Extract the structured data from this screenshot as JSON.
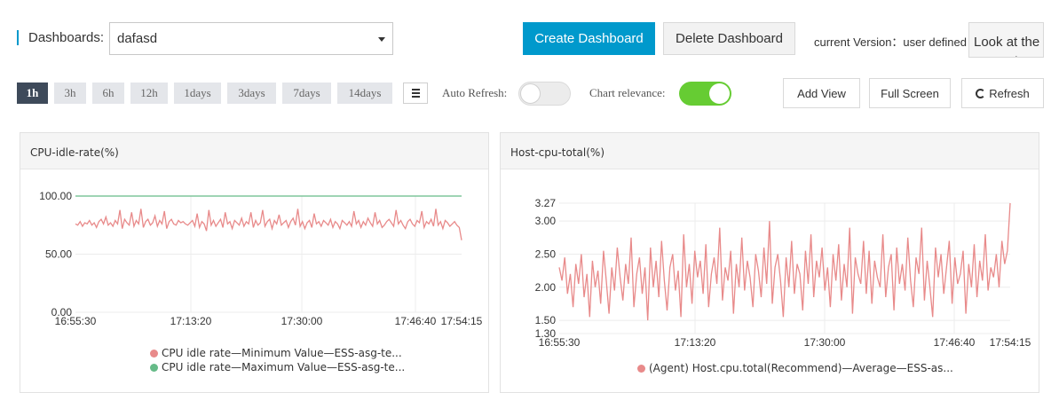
{
  "header": {
    "dashboards_label": "Dashboards:",
    "selected_dashboard": "dafasd",
    "create_label": "Create Dashboard",
    "delete_label": "Delete Dashboard",
    "version_label": "current Version：user defined",
    "look_label": "Look at the amount"
  },
  "toolbar": {
    "time_ranges": [
      "1h",
      "3h",
      "6h",
      "12h",
      "1days",
      "3days",
      "7days",
      "14days"
    ],
    "active_range": "1h",
    "auto_refresh_label": "Auto Refresh:",
    "auto_refresh_on": false,
    "chart_relevance_label": "Chart relevance:",
    "chart_relevance_on": true,
    "add_view_label": "Add View",
    "full_screen_label": "Full Screen",
    "refresh_label": "Refresh"
  },
  "colors": {
    "primary": "#0099cc",
    "series_red": "#e88a8a",
    "series_green": "#66bb88",
    "toggle_on": "#66cc33"
  },
  "chart_data": [
    {
      "type": "line",
      "title": "CPU-idle-rate(%)",
      "x_ticks": [
        "16:55:30",
        "17:13:20",
        "17:30:00",
        "17:46:40",
        "17:54:15"
      ],
      "y_ticks": [
        "0.00",
        "50.00",
        "100.00"
      ],
      "ylim": [
        0,
        100
      ],
      "grid": true,
      "legend_position": "bottom",
      "series": [
        {
          "name": "CPU idle rate—Minimum Value—ESS-asg-te...",
          "color": "#e88a8a",
          "values": [
            76,
            75,
            78,
            74,
            77,
            76,
            79,
            75,
            77,
            73,
            78,
            80,
            76,
            82,
            75,
            77,
            74,
            79,
            76,
            88,
            72,
            80,
            77,
            75,
            86,
            74,
            79,
            76,
            89,
            73,
            78,
            80,
            75,
            77,
            83,
            74,
            79,
            76,
            87,
            72,
            78,
            80,
            76,
            75,
            79,
            77,
            78,
            76,
            75,
            77,
            79,
            74,
            85,
            73,
            78,
            76,
            70,
            88,
            75,
            79,
            74,
            77,
            80,
            73,
            86,
            76,
            78,
            72,
            79,
            77,
            75,
            81,
            74,
            78,
            76,
            86,
            73,
            79,
            75,
            77,
            88,
            74,
            78,
            80,
            72,
            79,
            76,
            84,
            75,
            77,
            79,
            73,
            78,
            81,
            75,
            89,
            74,
            78,
            72,
            77,
            79,
            73,
            85,
            76,
            78,
            74,
            79,
            77,
            75,
            80,
            73,
            78,
            76,
            72,
            79,
            77,
            75,
            78,
            74,
            87,
            76,
            79,
            73,
            78,
            75,
            81,
            77,
            74,
            86,
            76,
            79,
            73,
            75,
            78,
            80,
            77,
            74,
            88,
            76,
            79,
            75,
            72,
            78,
            80,
            76,
            74,
            79,
            77,
            87,
            73,
            78,
            76,
            80,
            74,
            89,
            75,
            78,
            72,
            79,
            77,
            74,
            76,
            78,
            75,
            73,
            62
          ]
        },
        {
          "name": "CPU idle rate—Maximum Value—ESS-asg-te...",
          "color": "#66bb88",
          "values": [
            100,
            100
          ]
        }
      ]
    },
    {
      "type": "line",
      "title": "Host-cpu-total(%)",
      "x_ticks": [
        "16:55:30",
        "17:13:20",
        "17:30:00",
        "17:46:40",
        "17:54:15"
      ],
      "y_ticks": [
        "1.30",
        "1.50",
        "2.00",
        "2.50",
        "3.00",
        "3.27"
      ],
      "ylim": [
        1.3,
        3.27
      ],
      "grid": true,
      "legend_position": "bottom",
      "series": [
        {
          "name": "(Agent) Host.cpu.total(Recommend)—Average—ESS-as...",
          "color": "#e88a8a",
          "values": [
            2.3,
            2.1,
            2.45,
            1.9,
            2.2,
            1.7,
            2.35,
            2.05,
            2.5,
            1.85,
            2.2,
            1.55,
            2.4,
            2.0,
            2.25,
            1.75,
            2.55,
            2.1,
            1.6,
            2.3,
            1.95,
            2.6,
            2.15,
            1.8,
            2.35,
            2.05,
            2.75,
            1.7,
            2.2,
            2.45,
            1.9,
            2.3,
            1.5,
            2.6,
            2.0,
            2.4,
            1.85,
            2.7,
            2.1,
            1.65,
            2.3,
            2.5,
            1.95,
            2.25,
            1.55,
            2.8,
            2.0,
            2.35,
            1.75,
            2.55,
            2.15,
            2.4,
            1.9,
            2.65,
            1.7,
            2.2,
            2.45,
            2.05,
            2.9,
            1.8,
            2.3,
            2.1,
            2.55,
            1.6,
            2.35,
            2.0,
            2.75,
            1.95,
            2.4,
            2.15,
            1.7,
            2.5,
            2.25,
            1.85,
            2.6,
            2.05,
            3.0,
            1.75,
            2.3,
            2.5,
            2.1,
            1.55,
            2.45,
            2.0,
            2.7,
            1.9,
            2.35,
            2.2,
            1.65,
            2.55,
            2.05,
            2.8,
            1.85,
            2.4,
            2.15,
            2.6,
            1.95,
            2.3,
            1.7,
            2.5,
            2.1,
            2.65,
            1.8,
            2.35,
            2.0,
            2.9,
            1.6,
            2.45,
            2.2,
            2.05,
            2.7,
            1.9,
            2.55,
            1.75,
            2.4,
            2.15,
            2.0,
            2.8,
            1.85,
            2.3,
            2.5,
            1.65,
            2.6,
            2.05,
            2.35,
            1.95,
            2.75,
            2.1,
            1.7,
            2.45,
            2.2,
            2.9,
            1.8,
            2.4,
            2.0,
            1.55,
            2.6,
            2.15,
            2.5,
            1.9,
            2.3,
            2.7,
            1.75,
            2.45,
            2.05,
            2.2,
            2.55,
            1.6,
            2.35,
            2.0,
            2.65,
            1.85,
            2.4,
            2.1,
            2.8,
            1.95,
            2.3,
            2.15,
            2.5,
            2.0,
            2.7,
            2.35,
            2.55,
            3.27
          ]
        }
      ]
    }
  ]
}
